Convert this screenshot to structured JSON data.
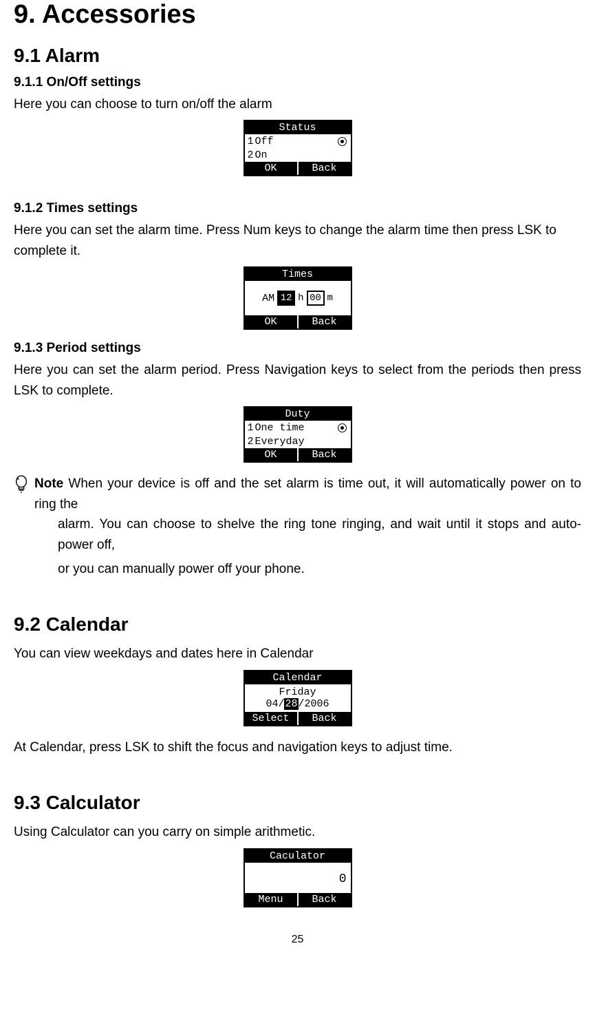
{
  "h1": "9. Accessories",
  "s91": {
    "title": "9.1 Alarm",
    "s911": {
      "title": "9.1.1 On/Off settings",
      "text": "Here you can choose to turn on/off the alarm"
    },
    "s912": {
      "title": "9.1.2 Times settings",
      "text": "Here you can set the alarm time. Press Num keys to change the alarm time then press LSK to complete it."
    },
    "s913": {
      "title": "9.1.3 Period settings",
      "text": "Here you can set the alarm period. Press Navigation keys to select from the periods then press LSK to complete."
    }
  },
  "note": {
    "lead": "Note",
    "line1": " When your device is off and the set alarm is time out, it will automatically power on to ring the",
    "line2": "alarm. You can choose to shelve the ring tone ringing, and wait until it stops and auto-power off,",
    "line3": "or you can manually power off your phone."
  },
  "s92": {
    "title": "9.2 Calendar",
    "text": "You can view weekdays and dates here in Calendar",
    "after": "At Calendar, press LSK to shift the focus and navigation keys to adjust time."
  },
  "s93": {
    "title": "9.3 Calculator",
    "text": "Using Calculator can you carry on simple arithmetic."
  },
  "screens": {
    "status": {
      "title": "Status",
      "row1_num": "1",
      "row1_lbl": "Off",
      "row2_num": "2",
      "row2_lbl": "On",
      "lsk": "OK",
      "rsk": "Back"
    },
    "times": {
      "title": "Times",
      "ampm": "AM",
      "hour": "12",
      "hunit": "h",
      "min": "00",
      "munit": "m",
      "lsk": "OK",
      "rsk": "Back"
    },
    "duty": {
      "title": "Duty",
      "row1_num": "1",
      "row1_lbl": "One time",
      "row2_num": "2",
      "row2_lbl": "Everyday",
      "lsk": "OK",
      "rsk": "Back"
    },
    "calendar": {
      "title": "Calendar",
      "day": "Friday",
      "date_pre": "04/",
      "date_hl": "28",
      "date_post": "/2006",
      "lsk": "Select",
      "rsk": "Back"
    },
    "calc": {
      "title": "Caculator",
      "value": "0",
      "lsk": "Menu",
      "rsk": "Back"
    }
  },
  "page": "25"
}
